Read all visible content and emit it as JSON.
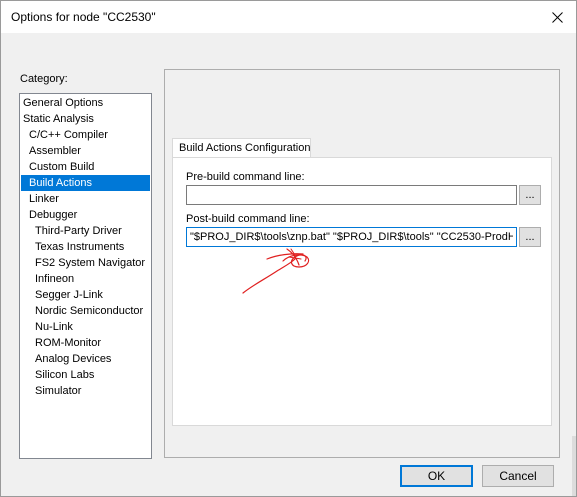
{
  "window": {
    "title": "Options for node \"CC2530\""
  },
  "category": {
    "label": "Category:",
    "items": [
      {
        "label": "General Options",
        "level": 0
      },
      {
        "label": "Static Analysis",
        "level": 0
      },
      {
        "label": "C/C++ Compiler",
        "level": 1
      },
      {
        "label": "Assembler",
        "level": 1
      },
      {
        "label": "Custom Build",
        "level": 1
      },
      {
        "label": "Build Actions",
        "level": 1,
        "selected": true
      },
      {
        "label": "Linker",
        "level": 1
      },
      {
        "label": "Debugger",
        "level": 1
      },
      {
        "label": "Third-Party Driver",
        "level": 2
      },
      {
        "label": "Texas Instruments",
        "level": 2
      },
      {
        "label": "FS2 System Navigator",
        "level": 2
      },
      {
        "label": "Infineon",
        "level": 2
      },
      {
        "label": "Segger J-Link",
        "level": 2
      },
      {
        "label": "Nordic Semiconductor",
        "level": 2
      },
      {
        "label": "Nu-Link",
        "level": 2
      },
      {
        "label": "ROM-Monitor",
        "level": 2
      },
      {
        "label": "Analog Devices",
        "level": 2
      },
      {
        "label": "Silicon Labs",
        "level": 2
      },
      {
        "label": "Simulator",
        "level": 2
      }
    ]
  },
  "panel": {
    "tab_label": "Build Actions Configuration",
    "prebuild_label": "Pre-build command line:",
    "prebuild_value": "",
    "postbuild_label": "Post-build command line:",
    "postbuild_value": "\"$PROJ_DIR$\\tools\\znp.bat\" \"$PROJ_DIR$\\tools\" \"CC2530-ProdH",
    "browse_label": "..."
  },
  "buttons": {
    "ok": "OK",
    "cancel": "Cancel"
  },
  "colors": {
    "selection": "#0078d7",
    "annotation": "#e02020"
  },
  "icons": {
    "close": "close-icon"
  }
}
